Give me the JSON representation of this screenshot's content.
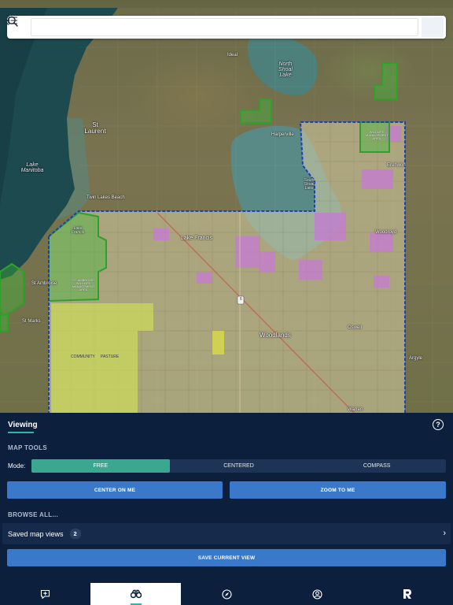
{
  "status": {
    "left": "",
    "right": ""
  },
  "search": {
    "placeholder": ""
  },
  "map": {
    "labels": {
      "ideal": "Ideal",
      "north_shoal_lake": "North Shoal Lake",
      "st_laurent": "St Laurent",
      "harperville": "Harperville",
      "lake_manitoba": "Lake Manitoba",
      "twin_lakes_beach": "Twin Lakes Beach",
      "erehwon": "Erehwon",
      "lake_francis_water": "Lake Francis",
      "lake_francis_town": "Lake Francis",
      "woodroyd": "Woodroyd",
      "st_ambroise": "St Ambroise",
      "st_marks": "St Marks",
      "woodlands": "Woodlands",
      "oswell": "Oswell",
      "argyle": "Argyle",
      "warren": "Warren",
      "community_pasture_1": "COMMUNITY",
      "community_pasture_2": "PASTURE",
      "route": "6",
      "wma_1": "ST. AMBROISE WILDLIFE MANAGEMENT AREA",
      "wma_2": "WILDLIFE MANAGEMENT AREA",
      "south_shoal_lake": "South Shoal Lake"
    },
    "colors": {
      "boundary": "#1a3fbf",
      "wma": "#2fa12a",
      "private": "#d7cfa6",
      "crown": "#c77ad6",
      "pasture": "#c9da5a"
    }
  },
  "panel": {
    "title": "Viewing",
    "help_icon": "?",
    "map_tools_heading": "MAP TOOLS",
    "mode_label": "Mode:",
    "modes": [
      {
        "label": "FREE",
        "active": true
      },
      {
        "label": "CENTERED",
        "active": false
      },
      {
        "label": "COMPASS",
        "active": false
      }
    ],
    "center_on_me": "CENTER ON ME",
    "zoom_to_me": "ZOOM TO ME",
    "browse_heading": "BROWSE ALL...",
    "saved_views_label": "Saved map views",
    "saved_views_count": "2",
    "saved_views_chevron": "›",
    "save_current_view": "SAVE CURRENT VIEW"
  },
  "tabbar": {
    "tabs": [
      {
        "icon": "add-note-icon",
        "active": false
      },
      {
        "icon": "binoculars-icon",
        "active": true
      },
      {
        "icon": "compass-icon",
        "active": false
      },
      {
        "icon": "profile-icon",
        "active": false
      },
      {
        "icon": "brand-r-icon",
        "active": false
      }
    ]
  }
}
